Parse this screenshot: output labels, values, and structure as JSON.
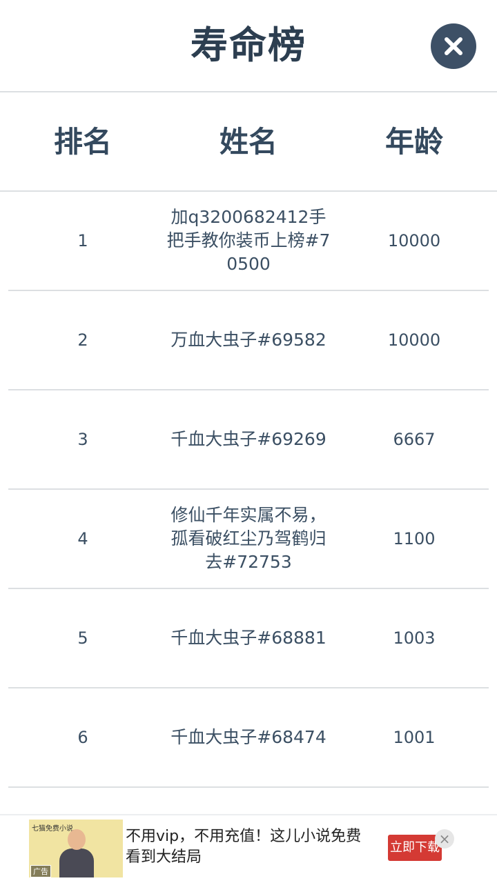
{
  "header": {
    "title": "寿命榜",
    "close_icon": "close-icon"
  },
  "table": {
    "columns": [
      "排名",
      "姓名",
      "年龄"
    ],
    "rows": [
      {
        "rank": "1",
        "name": "加q3200682412手把手教你装币上榜#70500",
        "age": "10000"
      },
      {
        "rank": "2",
        "name": "万血大虫子#69582",
        "age": "10000"
      },
      {
        "rank": "3",
        "name": "千血大虫子#69269",
        "age": "6667"
      },
      {
        "rank": "4",
        "name": "修仙千年实属不易，孤看破红尘乃驾鹤归去#72753",
        "age": "1100"
      },
      {
        "rank": "5",
        "name": "千血大虫子#68881",
        "age": "1003"
      },
      {
        "rank": "6",
        "name": "千血大虫子#68474",
        "age": "1001"
      }
    ]
  },
  "ad": {
    "brand": "七猫免费小说",
    "tag": "广告",
    "text": "不用vip，不用充值！这儿小说免费看到大结局",
    "cta": "立即下载",
    "close_label": "×"
  },
  "colors": {
    "primary_text": "#34495e",
    "close_button": "#3d5066",
    "ad_cta": "#d43a34"
  }
}
